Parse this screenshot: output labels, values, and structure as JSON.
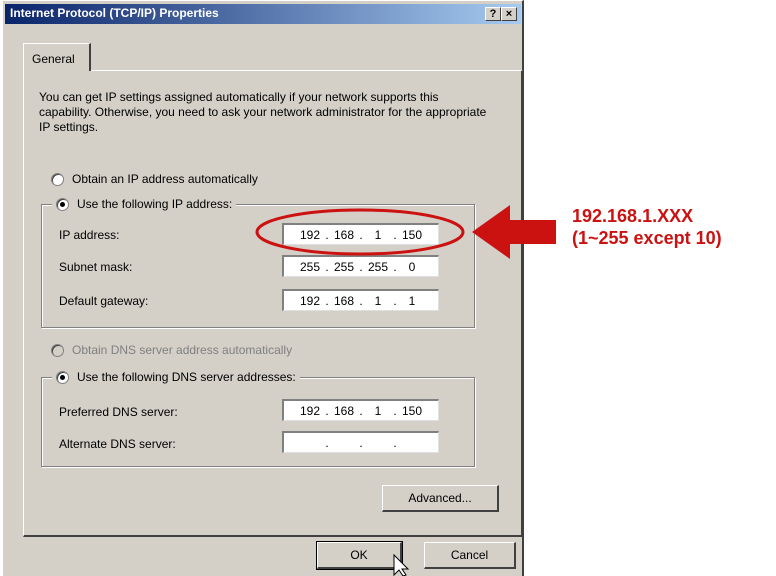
{
  "window": {
    "title": "Internet Protocol (TCP/IP) Properties",
    "help_label": "?",
    "close_label": "×"
  },
  "tabs": [
    {
      "label": "General",
      "active": true
    }
  ],
  "intro_text": "You can get IP settings assigned automatically if your network supports this capability. Otherwise, you need to ask your network administrator for the appropriate IP settings.",
  "ip_section": {
    "auto_label": "Obtain an IP address automatically",
    "manual_label": "Use the following IP address:",
    "selected": "manual",
    "fields": [
      {
        "label": "IP address:",
        "octets": [
          "192",
          "168",
          "1",
          "150"
        ]
      },
      {
        "label": "Subnet mask:",
        "octets": [
          "255",
          "255",
          "255",
          "0"
        ]
      },
      {
        "label": "Default gateway:",
        "octets": [
          "192",
          "168",
          "1",
          "1"
        ]
      }
    ]
  },
  "dns_section": {
    "auto_label": "Obtain DNS server address automatically",
    "auto_disabled": true,
    "manual_label": "Use the following DNS server addresses:",
    "selected": "manual",
    "fields": [
      {
        "label": "Preferred DNS server:",
        "octets": [
          "192",
          "168",
          "1",
          "150"
        ]
      },
      {
        "label": "Alternate DNS server:",
        "octets": [
          "",
          "",
          "",
          ""
        ]
      }
    ]
  },
  "buttons": {
    "advanced": "Advanced...",
    "ok": "OK",
    "cancel": "Cancel"
  },
  "annotation": {
    "line1": "192.168.1.XXX",
    "line2": "(1~255 except 10)",
    "color": "#cc1111"
  },
  "colors": {
    "dialog_bg": "#d4d0c8",
    "title_start": "#0a246a",
    "title_end": "#a6caf0"
  }
}
